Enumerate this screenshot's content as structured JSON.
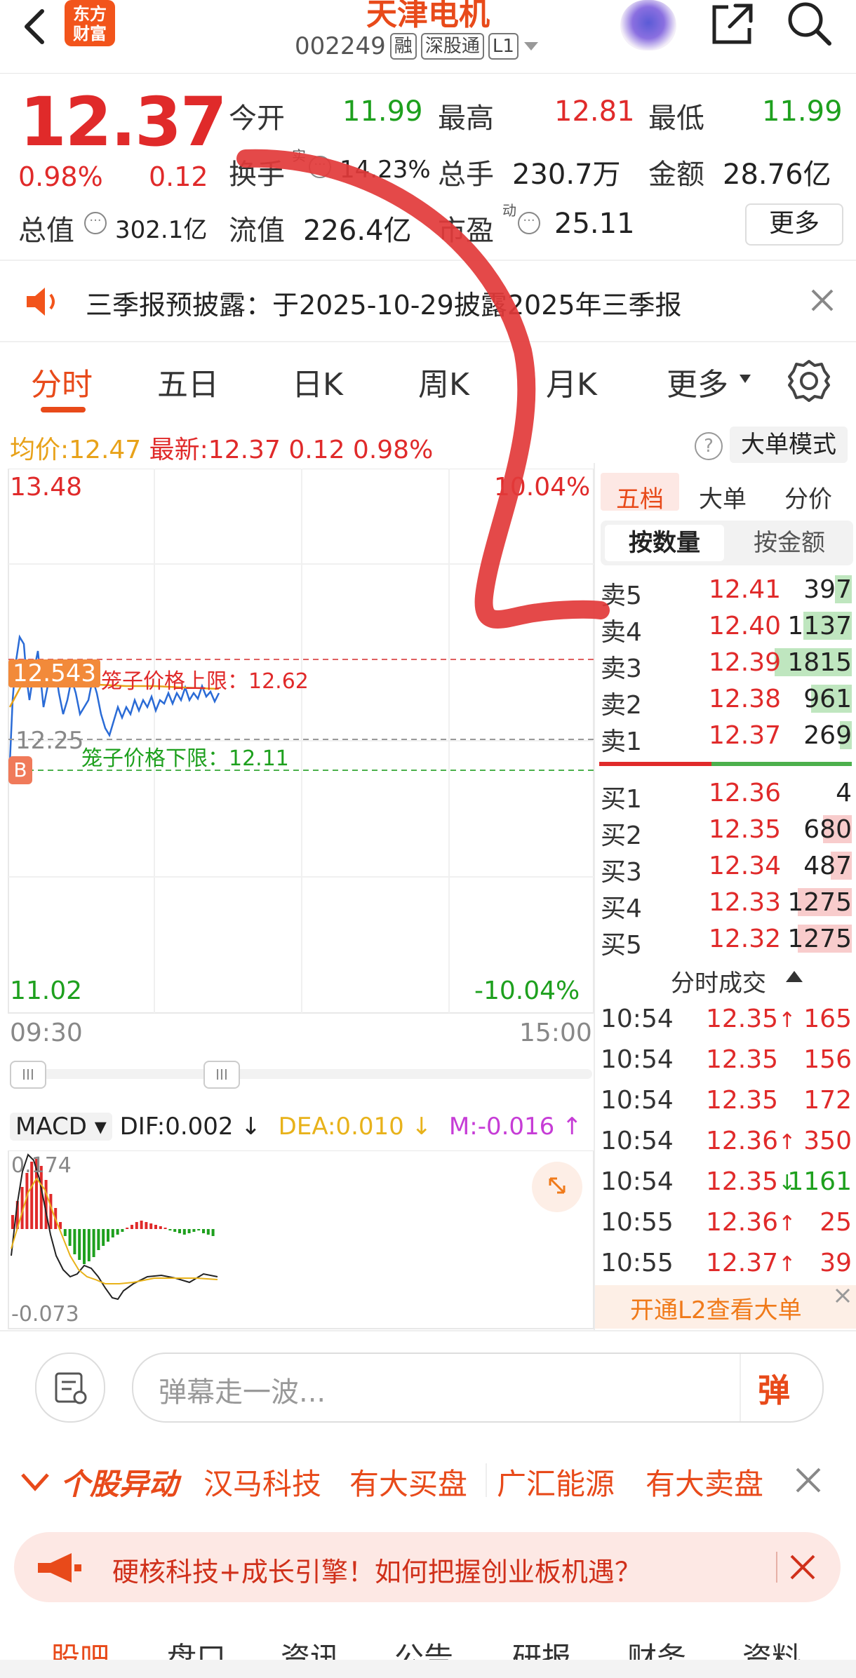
{
  "header": {
    "logo_line1": "东方",
    "logo_line2": "财富",
    "stock_name": "天津电机",
    "code": "002249",
    "tags": [
      "融",
      "深股通",
      "L1"
    ]
  },
  "quote": {
    "price": "12.37",
    "pct": "0.98%",
    "change": "0.12",
    "open_label": "今开",
    "open": "11.99",
    "high_label": "最高",
    "high": "12.81",
    "low_label": "最低",
    "low": "11.99",
    "turnover_label": "换手",
    "turnover_sup": "实",
    "turnover": "14.23%",
    "volume_label": "总手",
    "volume": "230.7万",
    "amount_label": "金额",
    "amount": "28.76亿",
    "mktcap_label": "总值",
    "mktcap": "302.1亿",
    "float_label": "流值",
    "float": "226.4亿",
    "pe_label": "市盈",
    "pe_sup": "动",
    "pe": "25.11",
    "more": "更多"
  },
  "notice": {
    "text": "三季报预披露：于2025-10-29披露2025年三季报"
  },
  "tabs": [
    "分时",
    "五日",
    "日K",
    "周K",
    "月K",
    "更多"
  ],
  "info": {
    "avg_label": "均价:",
    "avg": "12.47",
    "latest_label": "最新:",
    "latest": "12.37",
    "chg": "0.12",
    "pct": "0.98%",
    "help": "?",
    "big_mode": "大单模式"
  },
  "chart": {
    "top_price": "13.48",
    "top_pct": "10.04%",
    "bottom_price": "11.02",
    "bottom_pct": "-10.04%",
    "price_tag": "12.543",
    "mid_price": "12.25",
    "upper_limit": "笼子价格上限：12.62",
    "lower_limit": "笼子价格下限：12.11",
    "start_time": "09:30",
    "end_time": "15:00",
    "b_marker": "B",
    "scrollbar": "III"
  },
  "orderbook": {
    "tabs": [
      "五档",
      "大单",
      "分价"
    ],
    "subtabs": [
      "按数量",
      "按金额"
    ],
    "sells": [
      {
        "label": "卖5",
        "price": "12.41",
        "vol": "397",
        "ratio": 0.22
      },
      {
        "label": "卖4",
        "price": "12.40",
        "vol": "1137",
        "ratio": 0.63
      },
      {
        "label": "卖3",
        "price": "12.39",
        "vol": "1815",
        "ratio": 1.0
      },
      {
        "label": "卖2",
        "price": "12.38",
        "vol": "961",
        "ratio": 0.53
      },
      {
        "label": "卖1",
        "price": "12.37",
        "vol": "269",
        "ratio": 0.15
      }
    ],
    "buys": [
      {
        "label": "买1",
        "price": "12.36",
        "vol": "4",
        "ratio": 0.0
      },
      {
        "label": "买2",
        "price": "12.35",
        "vol": "680",
        "ratio": 0.37
      },
      {
        "label": "买3",
        "price": "12.34",
        "vol": "487",
        "ratio": 0.27
      },
      {
        "label": "买4",
        "price": "12.33",
        "vol": "1275",
        "ratio": 0.7
      },
      {
        "label": "买5",
        "price": "12.32",
        "vol": "1275",
        "ratio": 0.7
      }
    ],
    "trades_title": "分时成交",
    "trades": [
      {
        "time": "10:54",
        "price": "12.35",
        "dir": "↑",
        "vol": "165",
        "color": "red"
      },
      {
        "time": "10:54",
        "price": "12.35",
        "dir": "",
        "vol": "156",
        "color": "red"
      },
      {
        "time": "10:54",
        "price": "12.35",
        "dir": "",
        "vol": "172",
        "color": "red"
      },
      {
        "time": "10:54",
        "price": "12.36",
        "dir": "↑",
        "vol": "350",
        "color": "red"
      },
      {
        "time": "10:54",
        "price": "12.35",
        "dir": "↓",
        "vol": "1161",
        "color": "green"
      },
      {
        "time": "10:55",
        "price": "12.36",
        "dir": "↑",
        "vol": "25",
        "color": "red"
      },
      {
        "time": "10:55",
        "price": "12.37",
        "dir": "↑",
        "vol": "39",
        "color": "red"
      }
    ],
    "l2_banner": "开通L2查看大单"
  },
  "macd": {
    "select": "MACD",
    "dif": "DIF:0.002",
    "dif_arrow": "↓",
    "dea": "DEA:0.010",
    "dea_arrow": "↓",
    "m": "M:-0.016",
    "m_arrow": "↑",
    "top_val": "0.174",
    "bottom_val": "-0.073"
  },
  "danmu": {
    "placeholder": "弹幕走一波...",
    "send": "弹"
  },
  "yidong": {
    "title": "个股异动",
    "items": [
      "汉马科技",
      "有大买盘",
      "广汇能源",
      "有大卖盘"
    ]
  },
  "promo": {
    "text": "硬核科技+成长引擎！如何把握创业板机遇？"
  },
  "bottom_tabs": [
    "股吧",
    "盘口",
    "资讯",
    "公告",
    "研报",
    "财务",
    "资料"
  ],
  "colors": {
    "up": "#e02a2a",
    "down": "#1ea01e",
    "brand": "#e84a1a"
  }
}
